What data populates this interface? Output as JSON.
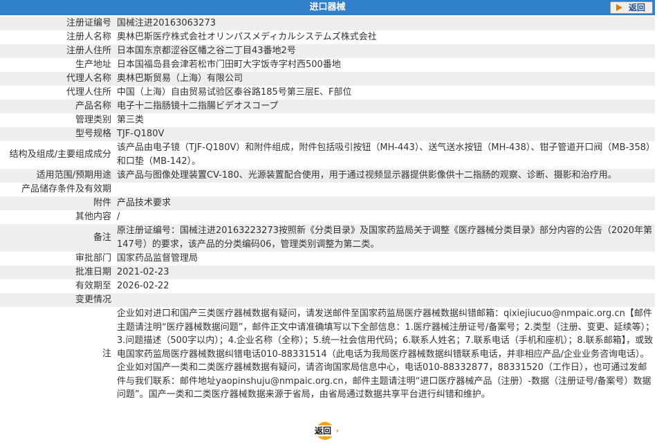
{
  "header": {
    "title": "进口器械",
    "back_label": "返回"
  },
  "colors": {
    "header_bg": "#2f7fca",
    "row_alt": "#eeeeee",
    "back_accent": "#f7a21a"
  },
  "rows": [
    {
      "label": "注册证编号",
      "value": "国械注进20163063273"
    },
    {
      "label": "注册人名称",
      "value": "奥林巴斯医疗株式会社オリンパスメディカルシステムズ株式会社"
    },
    {
      "label": "注册人住所",
      "value": "日本国东京都涩谷区幡之谷二丁目43番地2号"
    },
    {
      "label": "生产地址",
      "value": "日本国福岛县会津若松市门田町大字饭寺字村西500番地"
    },
    {
      "label": "代理人名称",
      "value": "奥林巴斯贸易（上海）有限公司"
    },
    {
      "label": "代理人住所",
      "value": "中国（上海）自由贸易试验区泰谷路185号第三层E、F部位"
    },
    {
      "label": "产品名称",
      "value": "电子十二指肠镜十二指腸ビデオスコープ"
    },
    {
      "label": "管理类别",
      "value": "第三类"
    },
    {
      "label": "型号规格",
      "value": "TJF-Q180V"
    },
    {
      "label": "结构及组成/主要组成成分",
      "value": "该产品由电子镜（TJF-Q180V）和附件组成，附件包括吸引按钮（MH-443）、送气送水按钮（MH-438）、钳子管道开口阀（MB-358）和口垫（MB-142）。"
    },
    {
      "label": "适用范围/预期用途",
      "value": "该产品与图像处理装置CV-180、光源装置配合使用，用于通过视频显示器提供影像供十二指肠的观察、诊断、摄影和治疗用。"
    },
    {
      "label": "产品储存条件及有效期",
      "value": ""
    },
    {
      "label": "附件",
      "value": "产品技术要求"
    },
    {
      "label": "其他内容",
      "value": "/"
    },
    {
      "label": "备注",
      "value": "原注册证编号：国械注进20163223273按照新《分类目录》及国家药监局关于调整《医疗器械分类目录》部分内容的公告（2020年第147号）的要求，该产品的分类编码06，管理类别调整为第二类。"
    },
    {
      "label": "审批部门",
      "value": "国家药品监督管理局"
    },
    {
      "label": "批准日期",
      "value": "2021-02-23"
    },
    {
      "label": "有效期至",
      "value": "2026-02-22"
    },
    {
      "label": "变更情况",
      "value": ""
    },
    {
      "label": "注",
      "value": "企业如对进口和国产三类医疗器械数据有疑问，请发送邮件至国家药监局医疗器械数据纠错邮箱：qixiejiucuo@nmpaic.org.cn【邮件主题请注明“医疗器械数据问题”，邮件正文中请准确填写以下全部信息：1.医疗器械注册证号/备案号；2.类型（注册、变更、延续等）；3.问题描述（500字以内）；4.企业名称（全称）；5.统一社会信用代码；6.联系人姓名；7.联系电话（手机和座机）；8.联系邮箱】，或致电国家药监局医疗器械数据纠错电话010-88331514（此电话为我局医疗器械数据纠错联系电话，并非相应产品/企业业务咨询电话）。企业如对国产一类和二类医疗器械数据有疑问，请咨询国家局信息中心，电话010-88332877，88331520（工作日），也可通过发邮件与我们联系：邮件地址yaopinshuju@nmpaic.org.cn，邮件主题请注明“进口医疗器械产品（注册）-数据（注册证号/备案号）数据问题”。国产一类和二类医疗器械数据来源于省局，由省局通过数据共享平台进行纠错和维护。"
    }
  ],
  "footer": {
    "back_label": "返回"
  }
}
